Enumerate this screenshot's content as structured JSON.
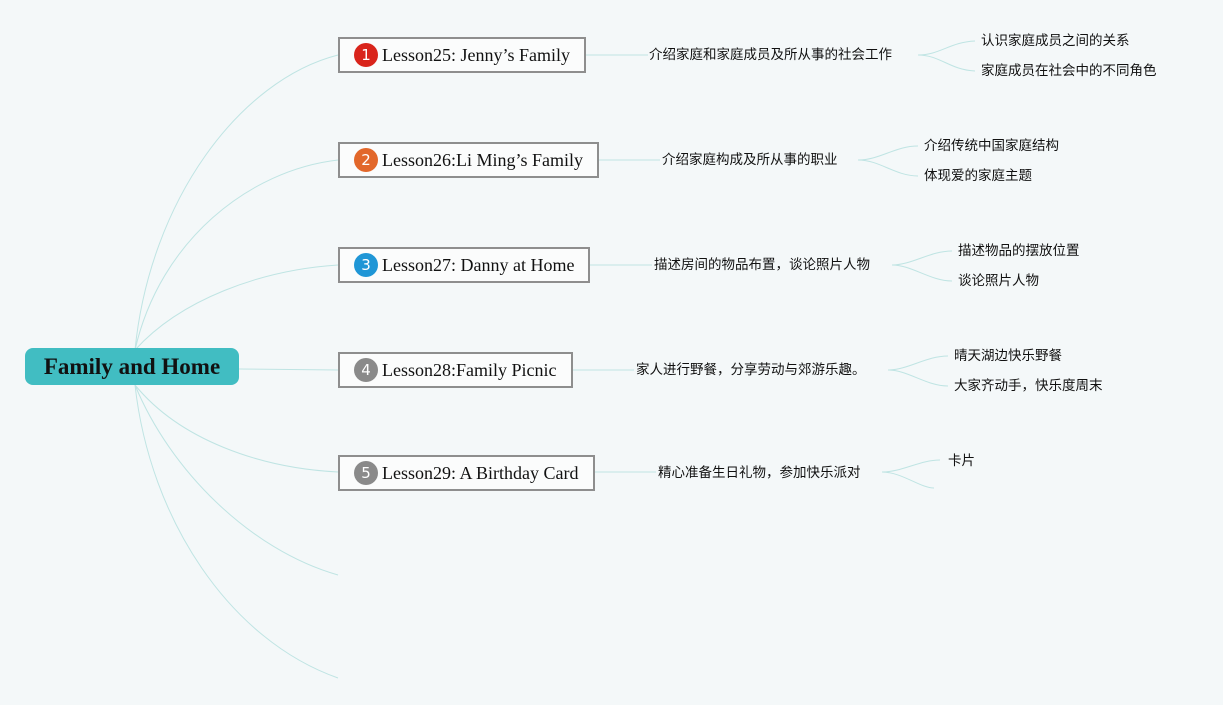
{
  "root": {
    "label": "Family and Home"
  },
  "colors": {
    "root_fill": "#41bdc2",
    "link": "#bfe4e3",
    "badge_1": "#d9241b",
    "badge_2": "#e2672a",
    "badge_3": "#1f96d6",
    "badge_4": "#8a8a8a",
    "badge_5": "#8a8a8a"
  },
  "lessons": [
    {
      "badge": "1",
      "title": "Lesson25: Jenny’s Family",
      "summary": "介绍家庭和家庭成员及所从事的社会工作",
      "details": [
        "认识家庭成员之间的关系",
        "家庭成员在社会中的不同角色"
      ]
    },
    {
      "badge": "2",
      "title": "Lesson26:Li Ming’s Family",
      "summary": "介绍家庭构成及所从事的职业",
      "details": [
        "介绍传统中国家庭结构",
        "体现爱的家庭主题"
      ]
    },
    {
      "badge": "3",
      "title": "Lesson27: Danny at Home",
      "summary": "描述房间的物品布置，谈论照片人物",
      "details": [
        "描述物品的摆放位置",
        "谈论照片人物"
      ]
    },
    {
      "badge": "4",
      "title": "Lesson28:Family Picnic",
      "summary": "家人进行野餐，分享劳动与郊游乐趣。",
      "details": [
        "晴天湖边快乐野餐",
        "大家齐动手，快乐度周末"
      ]
    },
    {
      "badge": "5",
      "title": "Lesson29: A Birthday Card",
      "summary": "精心准备生日礼物，参加快乐派对",
      "details": [
        "卡片",
        ""
      ]
    }
  ]
}
